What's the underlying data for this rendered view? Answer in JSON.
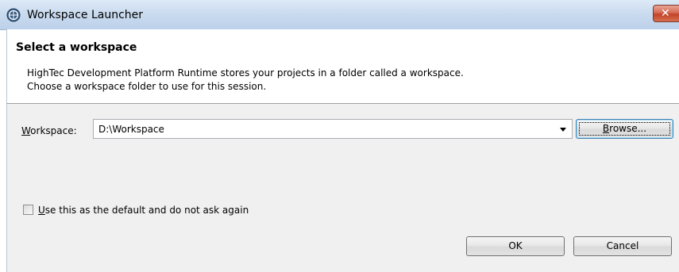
{
  "window": {
    "title": "Workspace Launcher",
    "close_glyph": "✕"
  },
  "header": {
    "title": "Select a workspace",
    "description": "HighTec Development Platform Runtime stores your projects in a folder called a workspace.\nChoose a workspace folder to use for this session."
  },
  "workspace": {
    "label_mnemonic": "W",
    "label_rest": "orkspace:",
    "value": "D:\\Workspace"
  },
  "buttons": {
    "browse_mnemonic": "B",
    "browse_rest": "rowse...",
    "ok": "OK",
    "cancel": "Cancel"
  },
  "default_option": {
    "label_mnemonic": "U",
    "label_rest": "se this as the default and do not ask again",
    "checked": false
  },
  "icons": {
    "app": "eclipse-app-icon",
    "close": "close-icon",
    "dropdown": "chevron-down-icon"
  },
  "colors": {
    "titlebar": "#c7d9ee",
    "close_button": "#c24328",
    "dialog_body": "#f0f0f0",
    "focus_border": "#3c7fb1"
  }
}
